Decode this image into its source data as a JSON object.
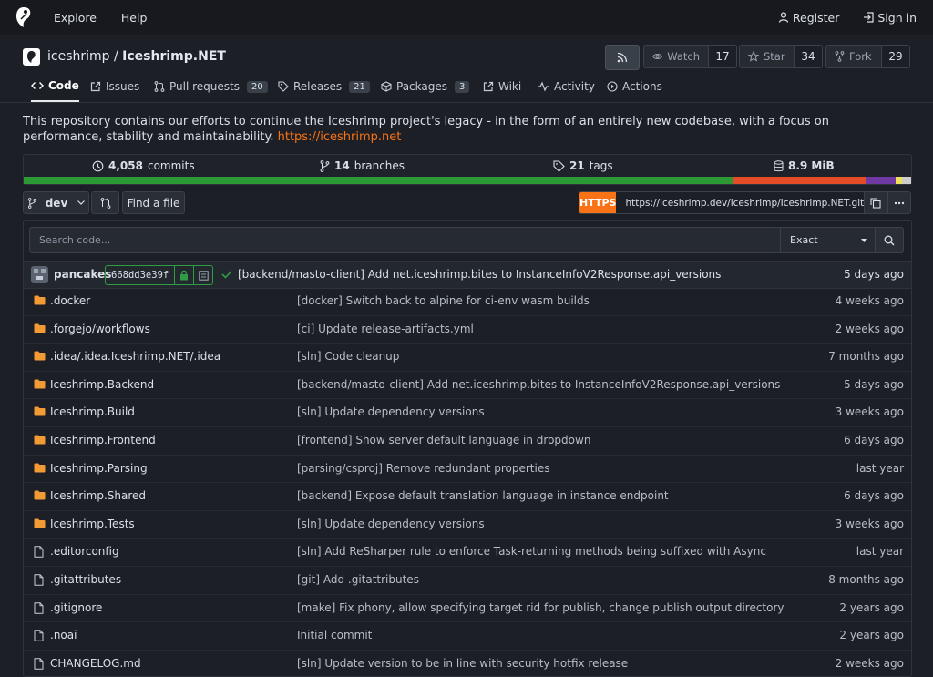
{
  "nav": {
    "explore": "Explore",
    "help": "Help",
    "register": "Register",
    "signin": "Sign in"
  },
  "repo": {
    "owner": "iceshrimp",
    "separator": "/",
    "name": "Iceshrimp.NET",
    "watch_label": "Watch",
    "watch_count": "17",
    "star_label": "Star",
    "star_count": "34",
    "fork_label": "Fork",
    "fork_count": "29"
  },
  "tabs": [
    {
      "label": "Code"
    },
    {
      "label": "Issues"
    },
    {
      "label": "Pull requests",
      "count": "20"
    },
    {
      "label": "Releases",
      "count": "21"
    },
    {
      "label": "Packages",
      "count": "3"
    },
    {
      "label": "Wiki"
    },
    {
      "label": "Activity"
    },
    {
      "label": "Actions"
    }
  ],
  "description": {
    "text": "This repository contains our efforts to continue the Iceshrimp project's legacy - in the form of an entirely new codebase, with a focus on performance, stability and maintainability.",
    "link": "https://iceshrimp.net"
  },
  "stats": {
    "commits_num": "4,058",
    "commits_label": "commits",
    "branches_num": "14",
    "branches_label": "branches",
    "tags_num": "21",
    "tags_label": "tags",
    "size": "8.9 MiB"
  },
  "language_colors": [
    "#2b9a35",
    "#e34c26",
    "#6f3aa3",
    "#f1e05a",
    "#cccccc"
  ],
  "language_shares": [
    0.8,
    0.15,
    0.033,
    0.007,
    0.01
  ],
  "toolbar": {
    "branch": "dev",
    "find_file": "Find a file",
    "clone_protocol": "HTTPS",
    "clone_url": "https://iceshrimp.dev/iceshrimp/Iceshrimp.NET.git"
  },
  "code_search": {
    "placeholder": "Search code...",
    "mode": "Exact"
  },
  "latest_commit": {
    "author": "pancakes",
    "sha": "668dd3e39f",
    "message": "[backend/masto-client] Add net.iceshrimp.bites to InstanceInfoV2Response.api_versions",
    "time": "5 days ago"
  },
  "files": [
    {
      "type": "dir",
      "name": ".docker",
      "message": "[docker] Switch back to alpine for ci-env wasm builds",
      "time": "4 weeks ago"
    },
    {
      "type": "dir",
      "name": ".forgejo/workflows",
      "message": "[ci] Update release-artifacts.yml",
      "time": "2 weeks ago"
    },
    {
      "type": "dir",
      "name": ".idea/.idea.Iceshrimp.NET/.idea",
      "message": "[sln] Code cleanup",
      "time": "7 months ago"
    },
    {
      "type": "dir",
      "name": "Iceshrimp.Backend",
      "message": "[backend/masto-client] Add net.iceshrimp.bites to InstanceInfoV2Response.api_versions",
      "time": "5 days ago"
    },
    {
      "type": "dir",
      "name": "Iceshrimp.Build",
      "message": "[sln] Update dependency versions",
      "time": "3 weeks ago"
    },
    {
      "type": "dir",
      "name": "Iceshrimp.Frontend",
      "message": "[frontend] Show server default language in dropdown",
      "time": "6 days ago"
    },
    {
      "type": "dir",
      "name": "Iceshrimp.Parsing",
      "message": "[parsing/csproj] Remove redundant properties",
      "time": "last year"
    },
    {
      "type": "dir",
      "name": "Iceshrimp.Shared",
      "message": "[backend] Expose default translation language in instance endpoint",
      "time": "6 days ago"
    },
    {
      "type": "dir",
      "name": "Iceshrimp.Tests",
      "message": "[sln] Update dependency versions",
      "time": "3 weeks ago"
    },
    {
      "type": "file",
      "name": ".editorconfig",
      "message": "[sln] Add ReSharper rule to enforce Task-returning methods being suffixed with Async",
      "time": "last year"
    },
    {
      "type": "file",
      "name": ".gitattributes",
      "message": "[git] Add .gitattributes",
      "time": "8 months ago"
    },
    {
      "type": "file",
      "name": ".gitignore",
      "message": "[make] Fix phony, allow specifying target rid for publish, change publish output directory",
      "time": "2 years ago"
    },
    {
      "type": "file",
      "name": ".noai",
      "message": "Initial commit",
      "time": "2 years ago"
    },
    {
      "type": "file",
      "name": "CHANGELOG.md",
      "message": "[sln] Update version to be in line with security hotfix release",
      "time": "2 weeks ago"
    }
  ]
}
